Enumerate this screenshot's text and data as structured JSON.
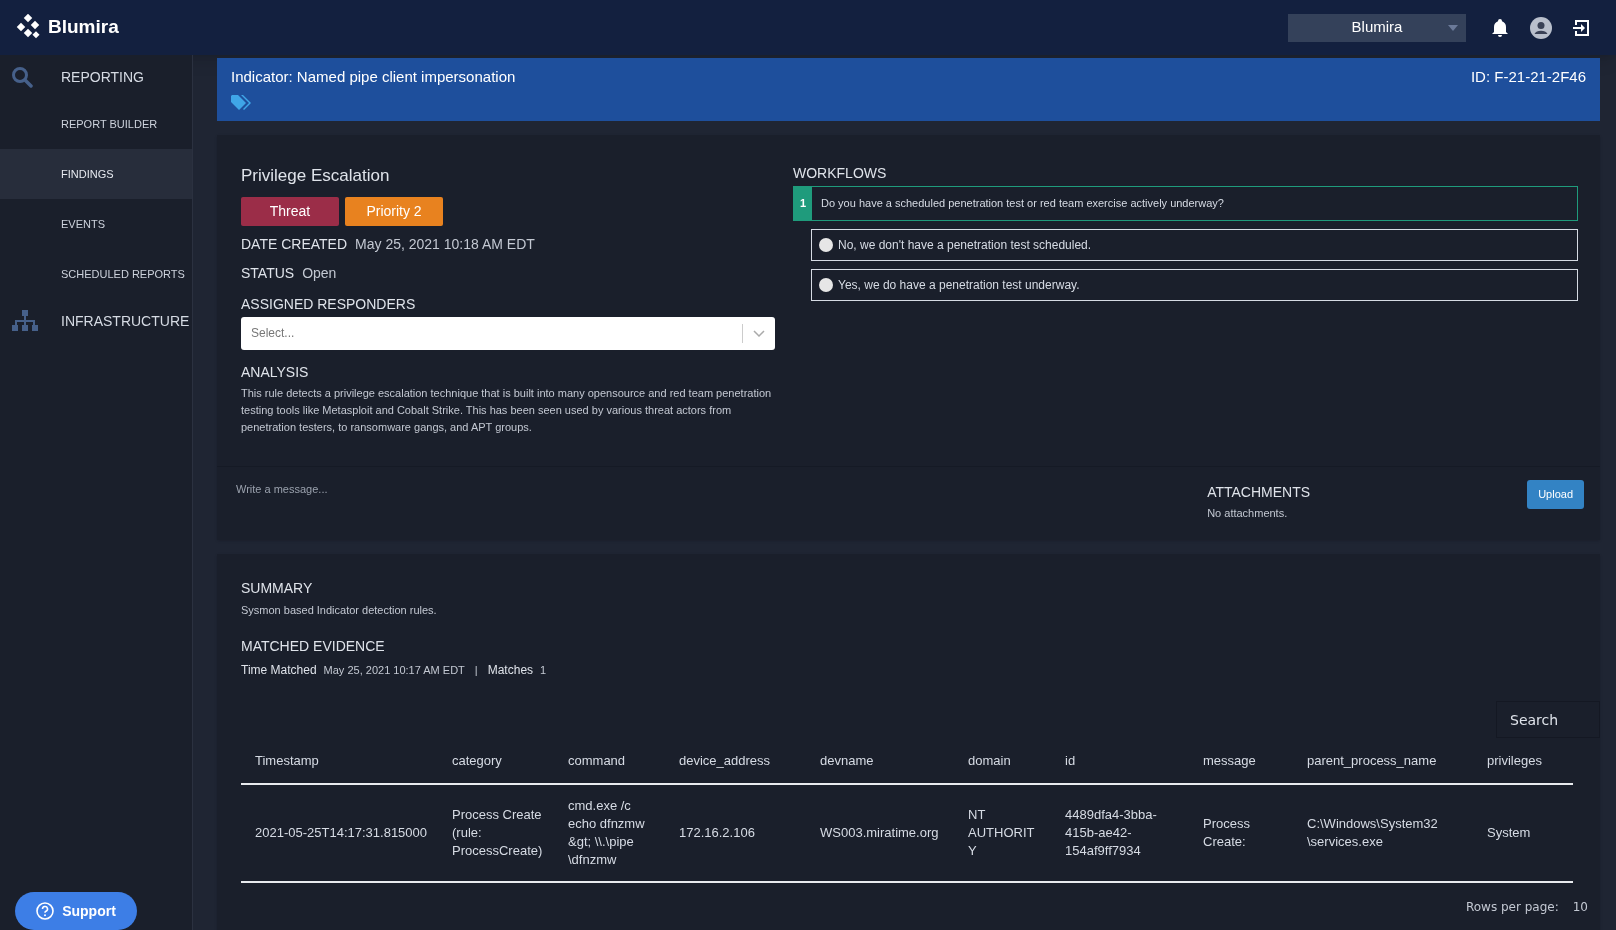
{
  "header": {
    "logo": "Blumira",
    "org_select": "Blumira"
  },
  "sidebar": {
    "sections": [
      {
        "label": "REPORTING",
        "kind": "search",
        "items": [
          {
            "label": "REPORT BUILDER",
            "selected": false
          },
          {
            "label": "FINDINGS",
            "selected": true
          },
          {
            "label": "EVENTS",
            "selected": false
          },
          {
            "label": "SCHEDULED REPORTS",
            "selected": false
          }
        ]
      },
      {
        "label": "INFRASTRUCTURE",
        "kind": "network"
      }
    ]
  },
  "support_button": "Support",
  "banner": {
    "title": "Indicator: Named pipe client impersonation",
    "id": "ID: F-21-21-2F46"
  },
  "finding": {
    "title": "Privilege Escalation",
    "badges": [
      {
        "label": "Threat",
        "color": "#9b2d48"
      },
      {
        "label": "Priority 2",
        "color": "#e8821f"
      }
    ],
    "fields": [
      {
        "label": "DATE CREATED",
        "value": "May 25, 2021 10:18 AM EDT"
      },
      {
        "label": "STATUS",
        "value": "Open"
      }
    ],
    "responders_label": "ASSIGNED RESPONDERS",
    "responders_placeholder": "Select...",
    "analysis_label": "ANALYSIS",
    "analysis": "This rule detects a privilege escalation technique that is built into many opensource and red team penetration testing tools like Metasploit and Cobalt Strike. This has been seen used by various threat actors from penetration testers, to ransomware gangs, and APT groups."
  },
  "workflows": {
    "label": "WORKFLOWS",
    "question_number": "1",
    "question": "Do you have a scheduled penetration test or red team exercise actively underway?",
    "options": [
      {
        "label": "No, we don't have a penetration test scheduled.",
        "selected": false
      },
      {
        "label": "Yes, we do have a penetration test underway.",
        "selected": false
      }
    ]
  },
  "message": {
    "placeholder": "Write a message..."
  },
  "attachments": {
    "label": "ATTACHMENTS",
    "text": "No attachments.",
    "button": "Upload"
  },
  "summary": {
    "label": "SUMMARY",
    "text": "Sysmon based Indicator detection rules."
  },
  "evidence": {
    "label": "MATCHED EVIDENCE",
    "time_label": "Time Matched",
    "time": "May 25, 2021 10:17 AM EDT",
    "separator": "|",
    "matches_label": "Matches",
    "matches": "1"
  },
  "table": {
    "search_placeholder": "Search",
    "columns": [
      "Timestamp",
      "category",
      "command",
      "device_address",
      "devname",
      "domain",
      "id",
      "message",
      "parent_process_name",
      "privileges"
    ],
    "rows": [
      [
        "2021-05-25T14:17:31.815000",
        "Process Create (rule: ProcessCreate)",
        "cmd.exe /c echo dfnzmw &gt; \\\\.\\pipe \\dfnzmw",
        "172.16.2.106",
        "WS003.miratime.org",
        "NT AUTHORITY",
        "4489dfa4-3bba-415b-ae42-154af9ff7934",
        "Process Create:",
        "C:\\Windows\\System32 \\services.exe",
        "System"
      ]
    ],
    "rows_per_page_label": "Rows per page:",
    "rows_per_page": "10"
  }
}
